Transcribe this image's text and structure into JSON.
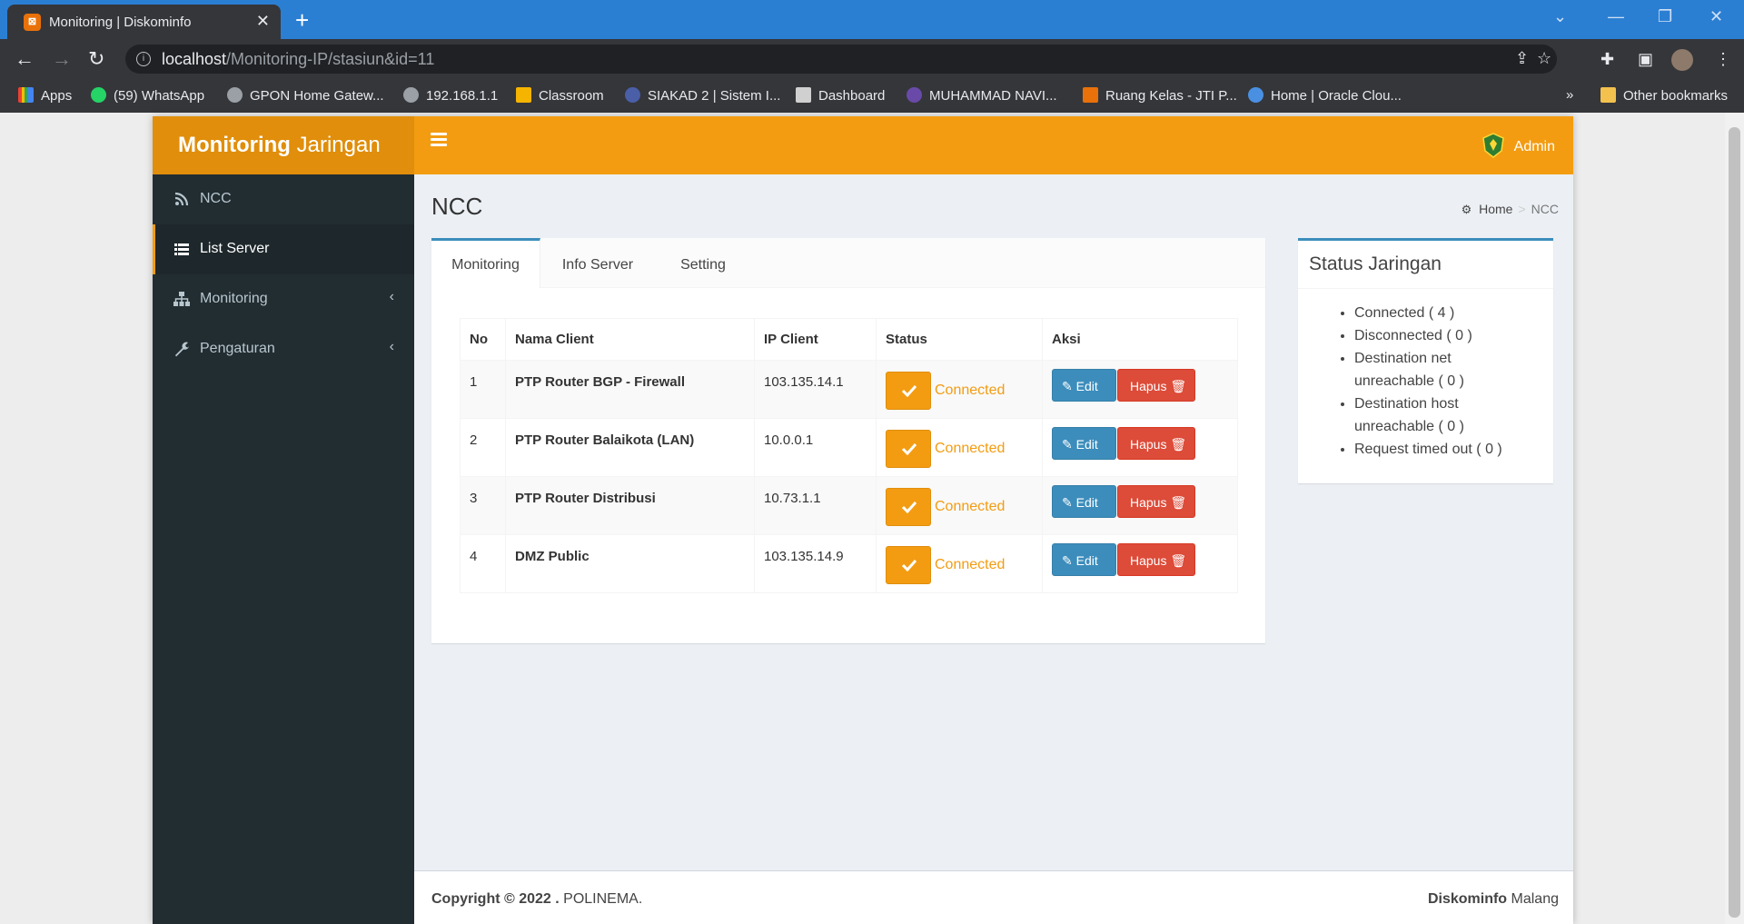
{
  "browser": {
    "tab_title": "Monitoring | Diskominfo",
    "url_host": "localhost",
    "url_path": "/Monitoring-IP/stasiun&id=11",
    "bookmarks": [
      {
        "label": "Apps",
        "color": "#ea4335"
      },
      {
        "label": "(59) WhatsApp",
        "color": "#25d366"
      },
      {
        "label": "GPON Home Gatew...",
        "color": "#9aa0a6"
      },
      {
        "label": "192.168.1.1",
        "color": "#9aa0a6"
      },
      {
        "label": "Classroom",
        "color": "#f4b400"
      },
      {
        "label": "SIAKAD 2 | Sistem I...",
        "color": "#4a5fa8"
      },
      {
        "label": "Dashboard",
        "color": "#d0d0d0"
      },
      {
        "label": "MUHAMMAD NAVI...",
        "color": "#6a4aa8"
      },
      {
        "label": "Ruang Kelas - JTI P...",
        "color": "#e8710a"
      },
      {
        "label": "Home | Oracle Clou...",
        "color": "#4a90e2"
      }
    ],
    "overflow": "»",
    "other_bookmarks": "Other bookmarks"
  },
  "app": {
    "logo_bold": "Monitoring",
    "logo_rest": " Jaringan",
    "user_name": "Admin",
    "accent": "#f39c12"
  },
  "sidebar": {
    "items": [
      {
        "label": "NCC",
        "icon": "rss-icon",
        "active": false,
        "chevron": ""
      },
      {
        "label": "List Server",
        "icon": "list-icon",
        "active": true,
        "chevron": ""
      },
      {
        "label": "Monitoring",
        "icon": "sitemap-icon",
        "active": false,
        "chevron": "‹"
      },
      {
        "label": "Pengaturan",
        "icon": "wrench-icon",
        "active": false,
        "chevron": "‹"
      }
    ]
  },
  "content": {
    "title": "NCC",
    "breadcrumb_home": "Home",
    "breadcrumb_sep": ">",
    "breadcrumb_current": "NCC"
  },
  "tabs": [
    "Monitoring",
    "Info Server",
    "Setting"
  ],
  "table": {
    "headers": [
      "No",
      "Nama Client",
      "IP Client",
      "Status",
      "Aksi"
    ],
    "rows": [
      {
        "no": "1",
        "name": "PTP Router BGP - Firewall",
        "ip": "103.135.14.1",
        "status": "Connected"
      },
      {
        "no": "2",
        "name": "PTP Router Balaikota (LAN)",
        "ip": "10.0.0.1",
        "status": "Connected"
      },
      {
        "no": "3",
        "name": "PTP Router Distribusi",
        "ip": "10.73.1.1",
        "status": "Connected"
      },
      {
        "no": "4",
        "name": "DMZ Public",
        "ip": "103.135.14.9",
        "status": "Connected"
      }
    ],
    "edit_label": "Edit",
    "delete_label": "Hapus"
  },
  "status_box": {
    "title": "Status Jaringan",
    "items": [
      "Connected ( 4 )",
      "Disconnected ( 0 )",
      "Destination net unreachable ( 0 )",
      "Destination host unreachable ( 0 )",
      "Request timed out ( 0 )"
    ]
  },
  "footer": {
    "copyright_bold": "Copyright © 2022 .",
    "copyright_rest": " POLINEMA.",
    "right_bold": "Diskominfo",
    "right_rest": " Malang"
  }
}
